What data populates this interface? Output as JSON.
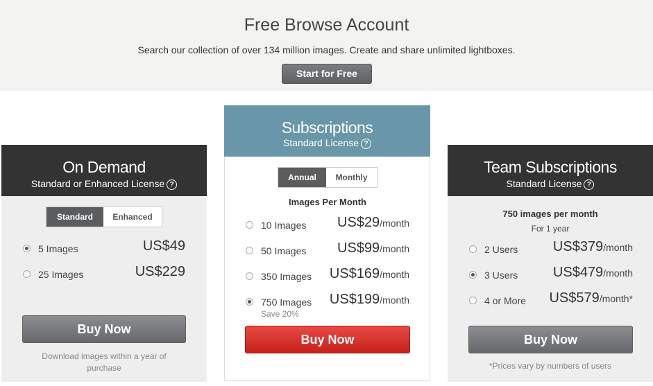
{
  "banner": {
    "title": "Free Browse Account",
    "description": "Search our collection of over 134 million images. Create and share unlimited lightboxes.",
    "button": "Start for Free"
  },
  "on_demand": {
    "title": "On Demand",
    "subtitle": "Standard or Enhanced License",
    "toggle": [
      "Standard",
      "Enhanced"
    ],
    "options": [
      {
        "label": "5 Images",
        "price": "US$49",
        "selected": true
      },
      {
        "label": "25 Images",
        "price": "US$229",
        "selected": false
      }
    ],
    "buy": "Buy Now",
    "note": "Download images within a year of purchase"
  },
  "subscriptions": {
    "title": "Subscriptions",
    "subtitle": "Standard License",
    "toggle": [
      "Annual",
      "Monthly"
    ],
    "heading": "Images Per Month",
    "per": "/month",
    "options": [
      {
        "label": "10 Images",
        "price": "US$29",
        "selected": false
      },
      {
        "label": "50 Images",
        "price": "US$99",
        "selected": false
      },
      {
        "label": "350 Images",
        "price": "US$169",
        "selected": false
      },
      {
        "label": "750 Images",
        "price": "US$199",
        "selected": true,
        "save": "Save 20%"
      }
    ],
    "buy": "Buy Now"
  },
  "team": {
    "title": "Team Subscriptions",
    "subtitle": "Standard License",
    "heading": "750 images per month",
    "period": "For 1 year",
    "per": "/month",
    "options": [
      {
        "label": "2 Users",
        "price": "US$379",
        "per": "/month",
        "selected": false
      },
      {
        "label": "3 Users",
        "price": "US$479",
        "per": "/month",
        "selected": true
      },
      {
        "label": "4 or More",
        "price": "US$579",
        "per": "/month*",
        "selected": false
      }
    ],
    "buy": "Buy Now",
    "note": "*Prices vary by numbers of users"
  },
  "colors": {
    "dark_header": "#333333",
    "sub_header": "#6996a8",
    "buy_red": "#d0241f"
  },
  "icons": {
    "help": "question-circle-icon"
  }
}
